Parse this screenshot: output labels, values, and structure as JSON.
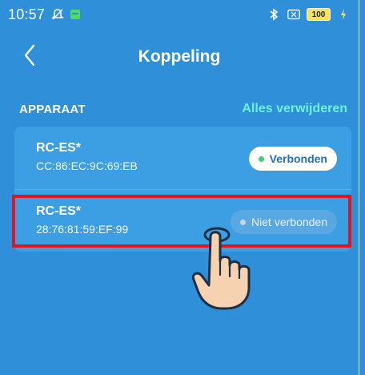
{
  "status_bar": {
    "time": "10:57",
    "battery": "100",
    "icons": [
      "mute-icon",
      "app-notification-icon",
      "bluetooth-icon",
      "no-sim-icon",
      "charging-icon"
    ]
  },
  "header": {
    "title": "Koppeling"
  },
  "section": {
    "title": "APPARAAT",
    "action": "Alles verwijderen"
  },
  "devices": [
    {
      "name": "RC-ES*",
      "mac": "CC:86:EC:9C:69:EB",
      "status": "Verbonden"
    },
    {
      "name": "RC-ES*",
      "mac": "28:76:81:59:EF:99",
      "status": "Niet verbonden"
    }
  ],
  "colors": {
    "background": "#2f8fd8",
    "card": "#3c9fe4",
    "accent": "#6ff0d7",
    "highlight": "#e3141b"
  }
}
